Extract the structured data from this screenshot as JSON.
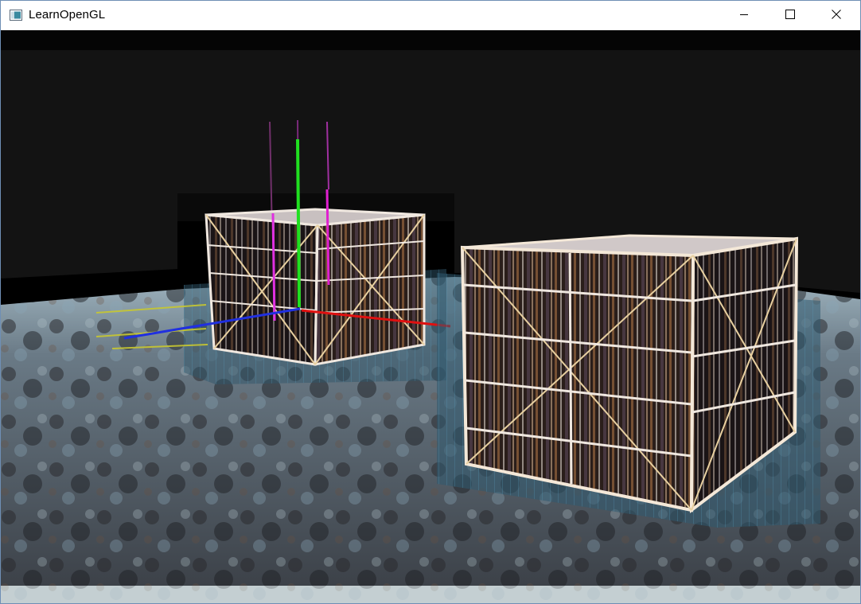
{
  "window": {
    "title": "LearnOpenGL",
    "app_icon": "console-window-icon",
    "controls": [
      {
        "name": "minimize-button",
        "icon": "minimize-icon"
      },
      {
        "name": "maximize-button",
        "icon": "maximize-icon"
      },
      {
        "name": "close-button",
        "icon": "close-icon"
      }
    ]
  },
  "scene": {
    "description_icons": [
      "crate-box",
      "axis-gizmo",
      "floor-plane",
      "back-wall"
    ],
    "colors": {
      "axis_x": "#e01010",
      "axis_y": "#20e020",
      "axis_z": "#2030e0",
      "crate_edge": "#f4e8d8",
      "floor": "#4a5560",
      "wall": "#141414"
    }
  }
}
